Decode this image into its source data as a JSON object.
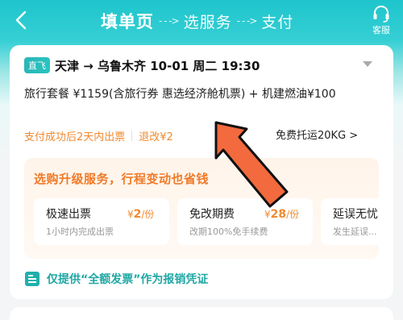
{
  "header": {
    "steps": [
      "填单页",
      "选服务",
      "支付"
    ],
    "arrow": "- - ->",
    "service_label": "客服"
  },
  "flight": {
    "badge": "直飞",
    "route": "天津 → 乌鲁木齐  10-01  周二  19:30"
  },
  "package": {
    "line": "旅行套餐 ¥1159(含旅行券 惠选经济舱机票) + 机建燃油¥100"
  },
  "notices": {
    "ticketing": "支付成功后2天内出票",
    "refund": "退改¥2",
    "baggage": "免费托运20KG >"
  },
  "upgrade": {
    "title": "选购升级服务，行程变动也省钱",
    "options": [
      {
        "name": "极速出票",
        "price_symbol": "¥",
        "price": "2",
        "unit": "/份",
        "desc": "1小时内完成出票"
      },
      {
        "name": "免改期费",
        "price_symbol": "¥",
        "price": "28",
        "unit": "/份",
        "desc": "改期100%免手续费"
      },
      {
        "name": "延误无忧",
        "price_symbol": "",
        "price": "",
        "unit": "",
        "desc": "发生延误..."
      }
    ]
  },
  "invoice": {
    "text": "仅提供“全额发票”作为报销凭证"
  },
  "colors": {
    "brand": "#1ec5cc",
    "accent_orange": "#f08a30",
    "annotation_arrow": "#f26a3d"
  }
}
